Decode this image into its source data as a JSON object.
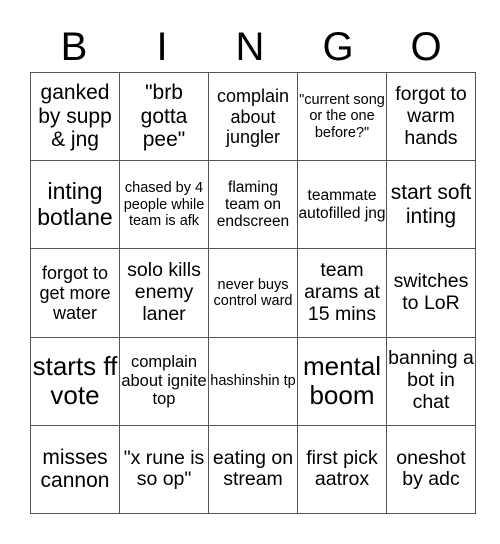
{
  "header": [
    "B",
    "I",
    "N",
    "G",
    "O"
  ],
  "rows": [
    [
      "ganked by supp & jng",
      "\"brb gotta pee\"",
      "complain about jungler",
      "\"current song or the one before?\"",
      "forgot to warm hands"
    ],
    [
      "inting botlane",
      "chased by 4 people while team is afk",
      "flaming team on endscreen",
      "teammate autofilled jng",
      "start soft inting"
    ],
    [
      "forgot to get more water",
      "solo kills enemy laner",
      "never buys control ward",
      "team arams at 15 mins",
      "switches to LoR"
    ],
    [
      "starts ff vote",
      "complain about ignite top",
      "hashinshin tp",
      "mental boom",
      "banning a bot in chat"
    ],
    [
      "misses cannon",
      "\"x rune is so op\"",
      "eating on stream",
      "first pick aatrox",
      "oneshot by adc"
    ]
  ]
}
